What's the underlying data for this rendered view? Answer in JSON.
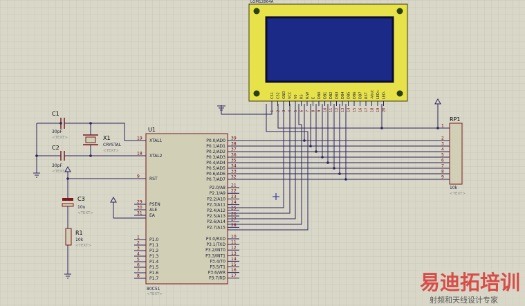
{
  "lcd": {
    "title": "LGM12864A",
    "pins": [
      "CS1",
      "CS2",
      "GND",
      "VCC",
      "V0",
      "RS",
      "R/W",
      "E",
      "DB0",
      "DB1",
      "DB2",
      "DB3",
      "DB4",
      "DB5",
      "DB6",
      "DB7",
      "RST",
      "-Vout",
      "LED+",
      "LED-"
    ],
    "pin_nums": [
      "1",
      "2",
      "3",
      "4",
      "5",
      "6",
      "7",
      "8",
      "9",
      "10",
      "11",
      "12",
      "13",
      "14",
      "15",
      "16",
      "17",
      "18",
      "19",
      "20"
    ]
  },
  "mcu": {
    "ref": "U1",
    "part": "80C51",
    "text": "<TEXT>",
    "left_pins": [
      {
        "name": "XTAL1",
        "num": "19"
      },
      {
        "name": "XTAL2",
        "num": "18"
      },
      {
        "name": "RST",
        "num": "9"
      },
      {
        "name": "PSEN",
        "num": "29"
      },
      {
        "name": "ALE",
        "num": "30"
      },
      {
        "name": "EA",
        "num": "31"
      },
      {
        "name": "P1.0",
        "num": "1"
      },
      {
        "name": "P1.1",
        "num": "2"
      },
      {
        "name": "P1.2",
        "num": "3"
      },
      {
        "name": "P1.3",
        "num": "4"
      },
      {
        "name": "P1.4",
        "num": "5"
      },
      {
        "name": "P1.5",
        "num": "6"
      },
      {
        "name": "P1.6",
        "num": "7"
      },
      {
        "name": "P1.7",
        "num": "8"
      }
    ],
    "right_pins": [
      {
        "name": "P0.0/AD0",
        "num": "39"
      },
      {
        "name": "P0.1/AD1",
        "num": "38"
      },
      {
        "name": "P0.2/AD2",
        "num": "37"
      },
      {
        "name": "P0.3/AD3",
        "num": "36"
      },
      {
        "name": "P0.4/AD4",
        "num": "35"
      },
      {
        "name": "P0.5/AD5",
        "num": "34"
      },
      {
        "name": "P0.6/AD6",
        "num": "33"
      },
      {
        "name": "P0.7/AD7",
        "num": "32"
      },
      {
        "name": "P2.0/A8",
        "num": "21"
      },
      {
        "name": "P2.1/A9",
        "num": "22"
      },
      {
        "name": "P2.2/A10",
        "num": "23"
      },
      {
        "name": "P2.3/A11",
        "num": "24"
      },
      {
        "name": "P2.4/A12",
        "num": "25"
      },
      {
        "name": "P2.5/A13",
        "num": "26"
      },
      {
        "name": "P2.6/A14",
        "num": "27"
      },
      {
        "name": "P2.7/A15",
        "num": "28"
      },
      {
        "name": "P3.0/RXD",
        "num": "10"
      },
      {
        "name": "P3.1/TXD",
        "num": "11"
      },
      {
        "name": "P3.2/INT0",
        "num": "12"
      },
      {
        "name": "P3.3/INT1",
        "num": "13"
      },
      {
        "name": "P3.4/T0",
        "num": "14"
      },
      {
        "name": "P3.5/T1",
        "num": "15"
      },
      {
        "name": "P3.6/WR",
        "num": "16"
      },
      {
        "name": "P3.7/RD",
        "num": "17"
      }
    ]
  },
  "components": {
    "c1": {
      "ref": "C1",
      "value": "30pF",
      "text": "<TEXT>"
    },
    "c2": {
      "ref": "C2",
      "value": "30pF",
      "text": "<TEXT>"
    },
    "x1": {
      "ref": "X1",
      "value": "CRYSTAL",
      "text": "<TEXT>"
    },
    "c3": {
      "ref": "C3",
      "value": "10u",
      "text": "<TEXT>"
    },
    "r1": {
      "ref": "R1",
      "value": "10k",
      "text": "<TEXT>"
    },
    "rp1": {
      "ref": "RP1",
      "value": "10k",
      "text": "<TEXT>",
      "pins": [
        "1",
        "2",
        "3",
        "4",
        "5",
        "6",
        "7",
        "8",
        "9"
      ]
    }
  },
  "watermark": {
    "line1": "易迪拓培训",
    "line2": "射频和天线设计专家"
  },
  "colors": {
    "background": "#d8d7c8",
    "grid": "#c6c5b4",
    "wire": "#2b2260",
    "chip_fill": "#d1cfb6",
    "lcd_bezel": "#e8e24a",
    "lcd_screen": "#1b2a86",
    "pin_number": "#7a0000",
    "watermark_red": "#d9201f"
  }
}
